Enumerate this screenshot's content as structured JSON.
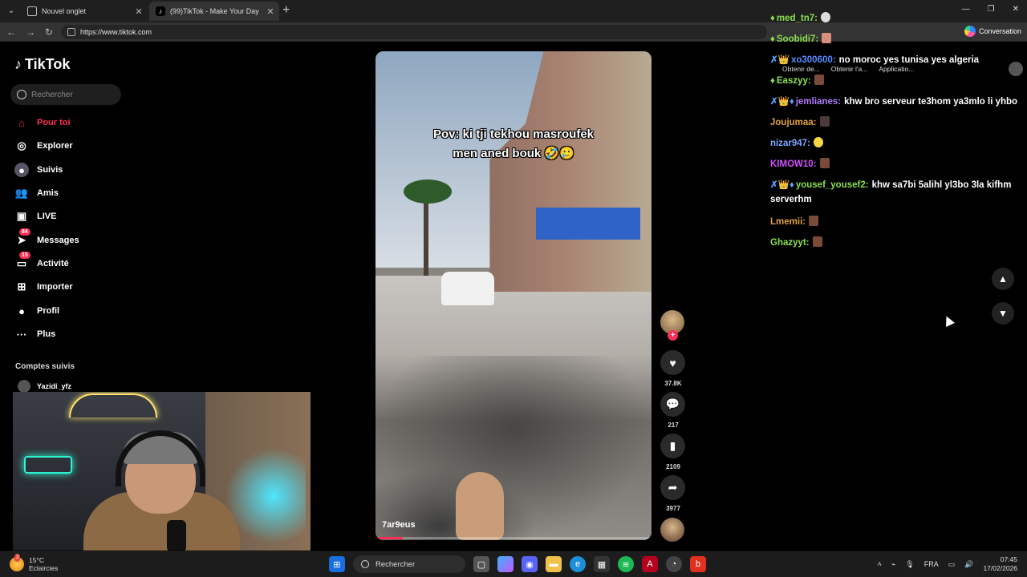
{
  "browser": {
    "tabs": [
      {
        "label": "Nouvel onglet"
      },
      {
        "label": "(99)TikTok - Make Your Day"
      }
    ],
    "url": "https://www.tiktok.com",
    "conversation_label": "Conversation"
  },
  "tiktok": {
    "brand": "TikTok",
    "search_placeholder": "Rechercher",
    "nav": [
      {
        "label": "Pour toi",
        "icon": "home-icon",
        "active": true
      },
      {
        "label": "Explorer",
        "icon": "compass-icon"
      },
      {
        "label": "Suivis",
        "icon": "following-avatar-icon"
      },
      {
        "label": "Amis",
        "icon": "friends-icon"
      },
      {
        "label": "LIVE",
        "icon": "live-icon"
      },
      {
        "label": "Messages",
        "icon": "messages-icon",
        "badge": "84"
      },
      {
        "label": "Activité",
        "icon": "activity-icon",
        "badge": "15"
      },
      {
        "label": "Importer",
        "icon": "upload-icon"
      },
      {
        "label": "Profil",
        "icon": "profile-icon"
      },
      {
        "label": "Plus",
        "icon": "more-icon"
      }
    ],
    "followed_title": "Comptes suivis",
    "followed_accounts": [
      "Yazidi_yfz"
    ],
    "video": {
      "caption_line1": "Pov: ki tji tekhou masroufek",
      "caption_line2": "men aned bouk 🤣🥲",
      "author": "7ar9eus",
      "progress": 0.1
    },
    "actions": {
      "likes": "37.8K",
      "comments": "217",
      "saves": "2109",
      "shares": "3977"
    }
  },
  "chat": [
    {
      "prefix": "♦",
      "user": "med_tn7:",
      "user_color": "#8be04e",
      "text": ""
    },
    {
      "prefix": "♦",
      "user": "Soobidi7:",
      "user_color": "#8be04e",
      "text": ""
    },
    {
      "prefix": "✗👑",
      "user": "xo300600:",
      "user_color": "#5b8cff",
      "text": "no moroc yes tunisa yes algeria"
    },
    {
      "prefix": "♦",
      "user": "Easzyy:",
      "user_color": "#8be04e",
      "text": ""
    },
    {
      "prefix": "✗👑♦",
      "user": "jemlianes:",
      "user_color": "#b07cff",
      "text": "khw bro serveur te3hom ya3mlo li yhbo"
    },
    {
      "prefix": "",
      "user": "Joujumaa:",
      "user_color": "#e0a040",
      "text": ""
    },
    {
      "prefix": "",
      "user": "nizar947:",
      "user_color": "#7aa7ff",
      "text": ""
    },
    {
      "prefix": "",
      "user": "KIMOW10:",
      "user_color": "#d44cff",
      "text": ""
    },
    {
      "prefix": "✗👑♦",
      "user": "yousef_yousef2:",
      "user_color": "#8be04e",
      "text": "khw sa7bi 5alihl yl3bo 3la kifhm serverhm"
    },
    {
      "prefix": "",
      "user": "Lmemii:",
      "user_color": "#e0a040",
      "text": ""
    },
    {
      "prefix": "",
      "user": "Ghazyyt:",
      "user_color": "#8be04e",
      "text": ""
    }
  ],
  "extensions": [
    "Obtenir de...",
    "Obtenir l'a...",
    "Applicatio..."
  ],
  "taskbar": {
    "weather_temp": "15°C",
    "weather_desc": "Eclaircies",
    "weather_badge": "2",
    "search_label": "Rechercher",
    "language": "FRA",
    "time": "07:45",
    "date": "17/02/2026"
  }
}
